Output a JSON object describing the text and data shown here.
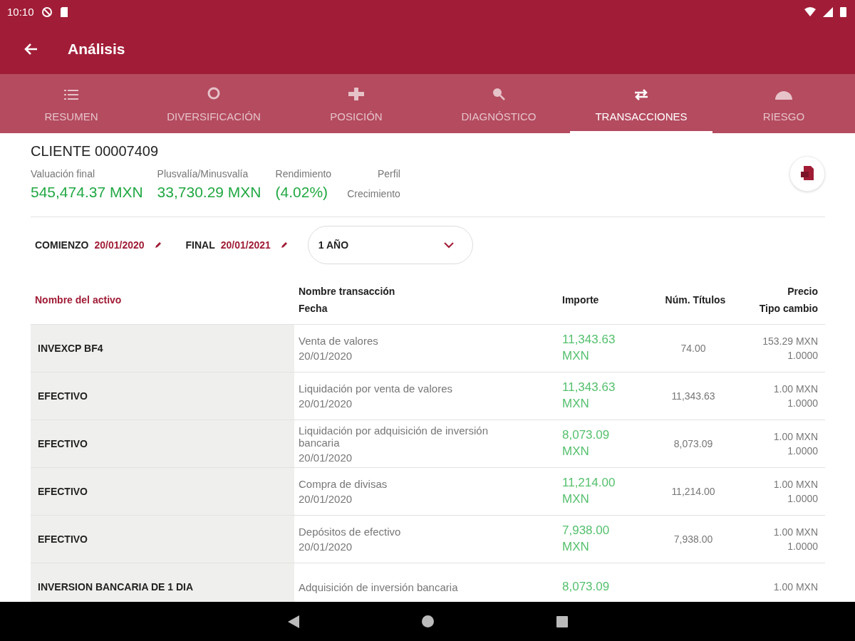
{
  "status_bar": {
    "time": "10:10"
  },
  "app_bar": {
    "title": "Análisis"
  },
  "tabs": [
    {
      "label": "RESUMEN",
      "kind": "list",
      "selected": false
    },
    {
      "label": "DIVERSIFICACIÓN",
      "kind": "ring",
      "selected": false
    },
    {
      "label": "POSICIÓN",
      "kind": "cross",
      "selected": false
    },
    {
      "label": "DIAGNÓSTICO",
      "kind": "search",
      "selected": false
    },
    {
      "label": "TRANSACCIONES",
      "kind": "swap",
      "selected": true
    },
    {
      "label": "RIESGO",
      "kind": "gauge",
      "selected": false
    }
  ],
  "client": {
    "title": "CLIENTE 00007409",
    "stats": [
      {
        "label": "Valuación final",
        "value": "545,474.37 MXN",
        "kind": "amount"
      },
      {
        "label": "Plusvalía/Minusvalía",
        "value": "33,730.29 MXN",
        "kind": "amount"
      },
      {
        "label": "Rendimiento",
        "value": "(4.02%)",
        "kind": "amount"
      },
      {
        "label": "Perfil",
        "value": "Crecimiento",
        "kind": "plain"
      }
    ]
  },
  "filters": {
    "start_label": "COMIENZO",
    "start_date": "20/01/2020",
    "end_label": "FINAL",
    "end_date": "20/01/2021",
    "period": "1 AÑO"
  },
  "table": {
    "columns": [
      {
        "lines": [
          "Nombre del activo"
        ],
        "sorted": true
      },
      {
        "lines": [
          "Nombre transacción",
          "Fecha"
        ],
        "sorted": false
      },
      {
        "lines": [
          "Importe"
        ],
        "sorted": false
      },
      {
        "lines": [
          "Núm. Títulos"
        ],
        "sorted": false
      },
      {
        "lines": [
          "Precio",
          "Tipo cambio"
        ],
        "sorted": false
      }
    ],
    "rows": [
      {
        "asset": "INVEXCP BF4",
        "transaction": "Venta de valores",
        "date": "20/01/2020",
        "amount": "11,343.63",
        "currency": "MXN",
        "titles": "74.00",
        "price": "153.29 MXN",
        "rate": "1.0000"
      },
      {
        "asset": "EFECTIVO",
        "transaction": "Liquidación por venta de valores",
        "date": "20/01/2020",
        "amount": "11,343.63",
        "currency": "MXN",
        "titles": "11,343.63",
        "price": "1.00 MXN",
        "rate": "1.0000"
      },
      {
        "asset": "EFECTIVO",
        "transaction": "Liquidación por adquisición de inversión bancaria",
        "date": "20/01/2020",
        "amount": "8,073.09",
        "currency": "MXN",
        "titles": "8,073.09",
        "price": "1.00 MXN",
        "rate": "1.0000"
      },
      {
        "asset": "EFECTIVO",
        "transaction": "Compra de divisas",
        "date": "20/01/2020",
        "amount": "11,214.00",
        "currency": "MXN",
        "titles": "11,214.00",
        "price": "1.00 MXN",
        "rate": "1.0000"
      },
      {
        "asset": "EFECTIVO",
        "transaction": "Depósitos de efectivo",
        "date": "20/01/2020",
        "amount": "7,938.00",
        "currency": "MXN",
        "titles": "7,938.00",
        "price": "1.00 MXN",
        "rate": "1.0000"
      },
      {
        "asset": "INVERSION BANCARIA DE 1 DIA",
        "transaction": "Adquisición de inversión bancaria",
        "amount": "8,073.09",
        "price": "1.00 MXN"
      }
    ]
  }
}
